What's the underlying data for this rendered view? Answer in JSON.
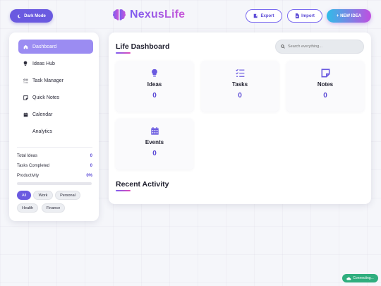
{
  "header": {
    "dark_mode_label": "Dark Mode",
    "logo_text": "NexusLife",
    "export_label": "Export",
    "import_label": "Import",
    "new_idea_label": "+ NEW IDEA"
  },
  "sidebar": {
    "items": [
      {
        "label": "Dashboard",
        "icon": "home-icon",
        "active": true
      },
      {
        "label": "Ideas Hub",
        "icon": "lightbulb-icon",
        "active": false
      },
      {
        "label": "Task Manager",
        "icon": "tasks-icon",
        "active": false
      },
      {
        "label": "Quick Notes",
        "icon": "note-icon",
        "active": false
      },
      {
        "label": "Calendar",
        "icon": "calendar-icon",
        "active": false
      },
      {
        "label": "Analytics",
        "icon": "",
        "active": false
      }
    ],
    "stats": {
      "total_ideas_label": "Total Ideas",
      "total_ideas": "0",
      "tasks_completed_label": "Tasks Completed",
      "tasks_completed": "0",
      "productivity_label": "Productivity",
      "productivity": "0%"
    },
    "productivity_fraction": 0,
    "filters": [
      "All",
      "Work",
      "Personal",
      "Health",
      "Finance"
    ],
    "active_filter": "All"
  },
  "main": {
    "title": "Life Dashboard",
    "search_placeholder": "Search everything...",
    "cards": [
      {
        "label": "Ideas",
        "value": "0",
        "icon": "lightbulb-icon"
      },
      {
        "label": "Tasks",
        "value": "0",
        "icon": "tasks-icon"
      },
      {
        "label": "Notes",
        "value": "0",
        "icon": "note-icon"
      },
      {
        "label": "Events",
        "value": "0",
        "icon": "calendar-icon"
      }
    ],
    "recent_title": "Recent Activity"
  },
  "status": {
    "connection": "Connecting..."
  },
  "colors": {
    "accent": "#6a5ae0",
    "accent_light": "#9b8cf2",
    "gradient_start": "#2fbde8",
    "gradient_end": "#c04fe0",
    "status_green": "#2fae7e"
  }
}
